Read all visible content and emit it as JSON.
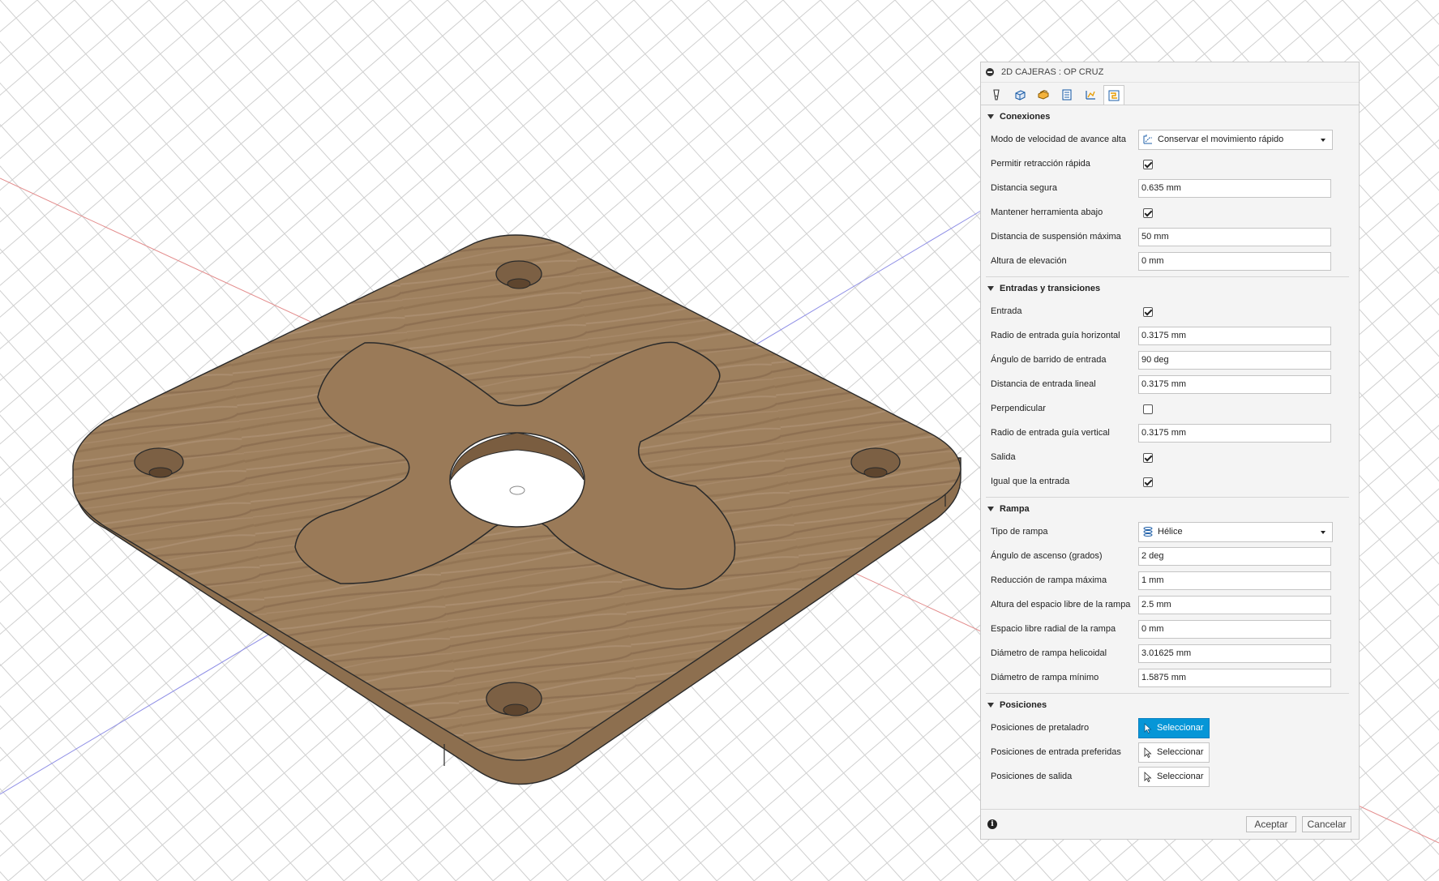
{
  "panel": {
    "title": "2D CAJERAS : OP CRUZ",
    "tabs": [
      {
        "icon": "tool-icon"
      },
      {
        "icon": "geometry-icon"
      },
      {
        "icon": "heights-icon"
      },
      {
        "icon": "passes-icon"
      },
      {
        "icon": "linking-icon"
      },
      {
        "icon": "connections-icon",
        "active": true
      }
    ],
    "sections": {
      "conexiones": {
        "title": "Conexiones",
        "modo_label": "Modo de velocidad de avance alta",
        "modo_value": "Conservar el movimiento rápido",
        "permitir_label": "Permitir retracción rápida",
        "permitir_checked": true,
        "distancia_segura_label": "Distancia segura",
        "distancia_segura_value": "0.635 mm",
        "mantener_label": "Mantener herramienta abajo",
        "mantener_checked": true,
        "suspension_label": "Distancia de suspensión máxima",
        "suspension_value": "50 mm",
        "elevacion_label": "Altura de elevación",
        "elevacion_value": "0 mm"
      },
      "entradas": {
        "title": "Entradas y transiciones",
        "entrada_label": "Entrada",
        "entrada_checked": true,
        "radio_h_label": "Radio de entrada guía horizontal",
        "radio_h_value": "0.3175 mm",
        "angulo_label": "Ángulo de barrido de entrada",
        "angulo_value": "90 deg",
        "dist_lineal_label": "Distancia de entrada lineal",
        "dist_lineal_value": "0.3175 mm",
        "perpendicular_label": "Perpendicular",
        "perpendicular_checked": false,
        "radio_v_label": "Radio de entrada guía vertical",
        "radio_v_value": "0.3175 mm",
        "salida_label": "Salida",
        "salida_checked": true,
        "igual_label": "Igual que la entrada",
        "igual_checked": true
      },
      "rampa": {
        "title": "Rampa",
        "tipo_label": "Tipo de rampa",
        "tipo_value": "Hélice",
        "angulo_ascenso_label": "Ángulo de ascenso (grados)",
        "angulo_ascenso_value": "2 deg",
        "reduccion_label": "Reducción de rampa máxima",
        "reduccion_value": "1 mm",
        "altura_label": "Altura del espacio libre de la rampa",
        "altura_value": "2.5 mm",
        "radial_label": "Espacio libre radial de la rampa",
        "radial_value": "0 mm",
        "diam_helicoidal_label": "Diámetro de rampa helicoidal",
        "diam_helicoidal_value": "3.01625 mm",
        "diam_minimo_label": "Diámetro de rampa mínimo",
        "diam_minimo_value": "1.5875 mm"
      },
      "posiciones": {
        "title": "Posiciones",
        "pretaladro_label": "Posiciones de pretaladro",
        "entrada_pref_label": "Posiciones de entrada preferidas",
        "salida_label": "Posiciones de salida",
        "select_label": "Seleccionar"
      }
    },
    "footer": {
      "info_glyph": "i",
      "ok_label": "Aceptar",
      "cancel_label": "Cancelar"
    }
  },
  "colors": {
    "accent": "#0696d7",
    "wood": "#9c7f5c",
    "grid": "#cfcfcf",
    "axis_x": "#e07070",
    "axis_y": "#7070e0"
  }
}
